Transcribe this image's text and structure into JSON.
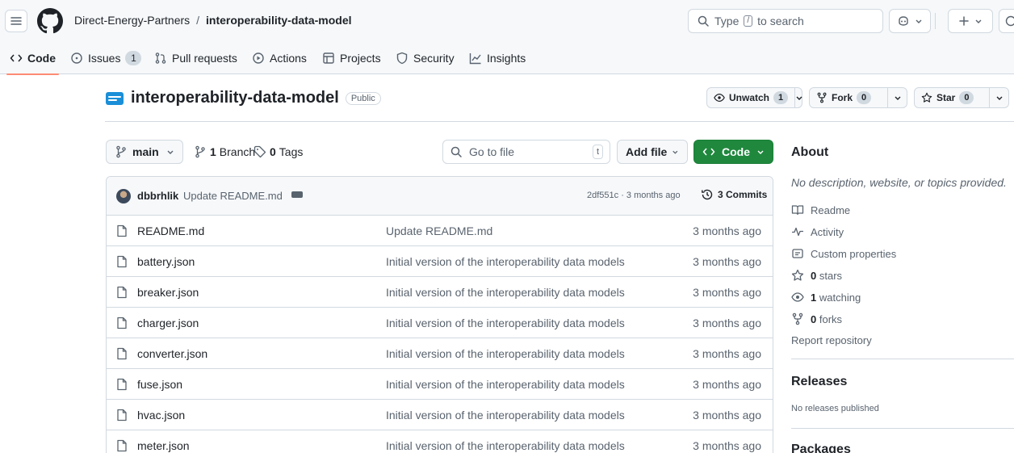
{
  "header": {
    "owner": "Direct-Energy-Partners",
    "separator": "/",
    "repo": "interoperability-data-model",
    "search_prefix": "Type",
    "search_key": "/",
    "search_suffix": "to search"
  },
  "nav": {
    "code": "Code",
    "issues": "Issues",
    "issues_count": "1",
    "pull_requests": "Pull requests",
    "actions": "Actions",
    "projects": "Projects",
    "security": "Security",
    "insights": "Insights"
  },
  "repo": {
    "name": "interoperability-data-model",
    "visibility": "Public",
    "unwatch_label": "Unwatch",
    "unwatch_count": "1",
    "fork_label": "Fork",
    "fork_count": "0",
    "star_label": "Star",
    "star_count": "0"
  },
  "toolbar": {
    "branch": "main",
    "branch_count": "1",
    "branch_label": "Branch",
    "tag_count": "0",
    "tag_label": "Tags",
    "goto_placeholder": "Go to file",
    "goto_key": "t",
    "add_file": "Add file",
    "code": "Code"
  },
  "latest_commit": {
    "user": "dbbrhlik",
    "message": "Update README.md",
    "hash_time": "2df551c · 3 months ago",
    "commits": "3 Commits"
  },
  "files": [
    {
      "name": "README.md",
      "message": "Update README.md",
      "date": "3 months ago"
    },
    {
      "name": "battery.json",
      "message": "Initial version of the interoperability data models",
      "date": "3 months ago"
    },
    {
      "name": "breaker.json",
      "message": "Initial version of the interoperability data models",
      "date": "3 months ago"
    },
    {
      "name": "charger.json",
      "message": "Initial version of the interoperability data models",
      "date": "3 months ago"
    },
    {
      "name": "converter.json",
      "message": "Initial version of the interoperability data models",
      "date": "3 months ago"
    },
    {
      "name": "fuse.json",
      "message": "Initial version of the interoperability data models",
      "date": "3 months ago"
    },
    {
      "name": "hvac.json",
      "message": "Initial version of the interoperability data models",
      "date": "3 months ago"
    },
    {
      "name": "meter.json",
      "message": "Initial version of the interoperability data models",
      "date": "3 months ago"
    }
  ],
  "sidebar": {
    "about_heading": "About",
    "description": "No description, website, or topics provided.",
    "readme": "Readme",
    "activity": "Activity",
    "custom_properties": "Custom properties",
    "stars_count": "0",
    "stars_label": "stars",
    "watching_count": "1",
    "watching_label": "watching",
    "forks_count": "0",
    "forks_label": "forks",
    "report": "Report repository",
    "releases_heading": "Releases",
    "releases_none": "No releases published",
    "packages_heading": "Packages"
  },
  "colors": {
    "accent_green": "#1f883d",
    "nav_underline": "#fd8c73",
    "border": "#d1d9e0",
    "muted_text": "#59636e"
  }
}
